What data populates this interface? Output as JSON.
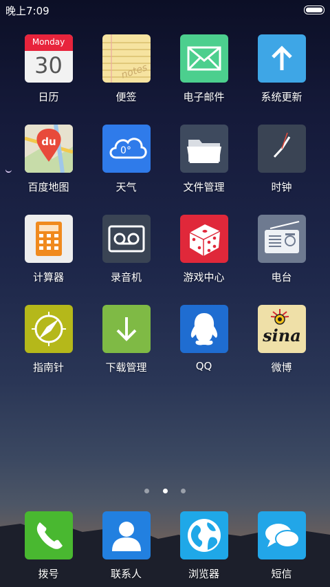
{
  "status": {
    "time": "晚上7:09"
  },
  "calendar_day": "Monday",
  "calendar_date": "30",
  "notes_text": "notes",
  "apps": [
    {
      "label": "日历",
      "icon": "calendar-icon"
    },
    {
      "label": "便签",
      "icon": "notes-icon"
    },
    {
      "label": "电子邮件",
      "icon": "email-icon"
    },
    {
      "label": "系统更新",
      "icon": "system-update-icon"
    },
    {
      "label": "百度地图",
      "icon": "baidu-map-icon"
    },
    {
      "label": "天气",
      "icon": "weather-icon"
    },
    {
      "label": "文件管理",
      "icon": "file-manager-icon"
    },
    {
      "label": "时钟",
      "icon": "clock-icon"
    },
    {
      "label": "计算器",
      "icon": "calculator-icon"
    },
    {
      "label": "录音机",
      "icon": "recorder-icon"
    },
    {
      "label": "游戏中心",
      "icon": "game-center-icon"
    },
    {
      "label": "电台",
      "icon": "radio-icon"
    },
    {
      "label": "指南针",
      "icon": "compass-icon"
    },
    {
      "label": "下载管理",
      "icon": "download-manager-icon"
    },
    {
      "label": "QQ",
      "icon": "qq-icon"
    },
    {
      "label": "微博",
      "icon": "weibo-icon"
    }
  ],
  "page_indicator": {
    "total": 3,
    "current": 2
  },
  "dock": [
    {
      "label": "拨号",
      "icon": "phone-icon"
    },
    {
      "label": "联系人",
      "icon": "contacts-icon"
    },
    {
      "label": "浏览器",
      "icon": "browser-icon"
    },
    {
      "label": "短信",
      "icon": "messages-icon"
    }
  ],
  "colors": {
    "calendar_red": "#e8243c",
    "notes_yellow": "#f6e3a0",
    "email_green": "#4ccf8e",
    "update_blue": "#3ea6e6",
    "weather_blue": "#2f7bea",
    "game_red": "#e0283a",
    "compass_yellowgreen": "#b5b81a",
    "download_green": "#7fba45",
    "qq_blue": "#1f6dd1",
    "phone_green": "#49b830",
    "contacts_blue": "#2280e0",
    "browser_cyan": "#1fa8e8",
    "messages_cyan": "#22a6e8"
  }
}
